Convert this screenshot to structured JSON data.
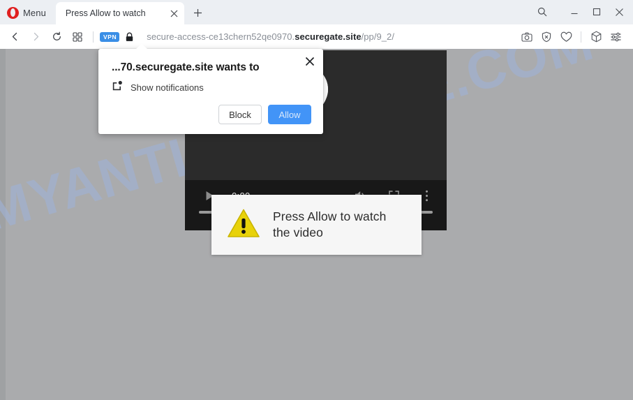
{
  "browser": {
    "menu_label": "Menu",
    "logo_color": "#e02020",
    "tab": {
      "title": "Press Allow to watch",
      "close_icon": "close-icon"
    },
    "new_tab_icon": "plus-icon",
    "window_controls": {
      "search_icon": "search-icon",
      "minimize_icon": "minimize-icon",
      "maximize_icon": "maximize-icon",
      "close_icon": "close-icon"
    },
    "toolbar": {
      "back_icon": "chevron-left-icon",
      "forward_icon": "chevron-right-icon",
      "reload_icon": "reload-icon",
      "tiles_icon": "grid-icon",
      "vpn_label": "VPN",
      "vpn_color": "#3a8ee6",
      "lock_icon": "lock-icon",
      "url_prefix": "secure-access-ce13chern52qe0970.",
      "url_domain": "securegate.site",
      "url_path": "/pp/9_2/",
      "right_icons": [
        {
          "name": "camera-icon"
        },
        {
          "name": "shield-block-icon"
        },
        {
          "name": "heart-icon"
        },
        {
          "name": "cube-wallet-icon"
        },
        {
          "name": "sliders-settings-icon"
        }
      ]
    }
  },
  "page": {
    "background_color": "#aaabad",
    "watermark": "MYANTISPYWARE.COM",
    "watermark_color": "#9fb2d6"
  },
  "video_player": {
    "play_icon": "play-icon",
    "time": "0:00",
    "volume_icon": "volume-icon",
    "fullscreen_icon": "fullscreen-icon",
    "more_icon": "more-vertical-icon",
    "background_color": "#2b2b2b",
    "controls_color": "#181818"
  },
  "warning_box": {
    "icon": "warning-triangle-icon",
    "icon_color": "#e8d20a",
    "line1": "Press Allow to watch",
    "line2": "the video"
  },
  "permission_popup": {
    "title": "...70.securegate.site wants to",
    "permission_icon": "notification-bell-icon",
    "permission_label": "Show notifications",
    "block_label": "Block",
    "allow_label": "Allow",
    "allow_color": "#4294f7",
    "close_icon": "close-icon"
  }
}
